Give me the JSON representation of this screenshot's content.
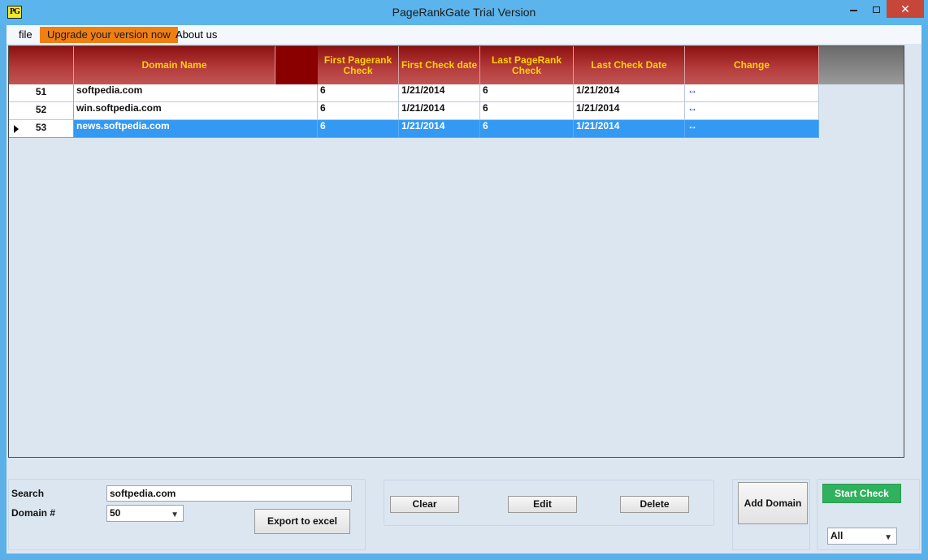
{
  "window": {
    "title": "PageRankGate Trial Version",
    "icon_text": "PG",
    "close_glyph": "✕"
  },
  "menu": {
    "file": "file",
    "upgrade": "Upgrade your version now",
    "about": "About us"
  },
  "colors": {
    "header_bg": "#b43a3a",
    "header_text": "#ffd200",
    "selection": "#3399f2",
    "upgrade_bg": "#f07f12",
    "start_check_bg": "#2fb15d"
  },
  "table": {
    "columns": [
      "Domain Name",
      "First Pagerank Check",
      "First Check date",
      "Last PageRank Check",
      "Last Check Date",
      "Change"
    ],
    "rows": [
      {
        "num": "51",
        "domain": "softpedia.com",
        "first_pr": "6",
        "first_date": "1/21/2014",
        "last_pr": "6",
        "last_date": "1/21/2014",
        "change": "↔",
        "selected": false
      },
      {
        "num": "52",
        "domain": "win.softpedia.com",
        "first_pr": "6",
        "first_date": "1/21/2014",
        "last_pr": "6",
        "last_date": "1/21/2014",
        "change": "↔",
        "selected": false
      },
      {
        "num": "53",
        "domain": "news.softpedia.com",
        "first_pr": "6",
        "first_date": "1/21/2014",
        "last_pr": "6",
        "last_date": "1/21/2014",
        "change": "↔",
        "selected": true
      }
    ]
  },
  "search": {
    "label": "Search",
    "value": "softpedia.com",
    "domain_label": "Domain #",
    "domain_value": "50",
    "export_label": "Export to excel"
  },
  "actions": {
    "clear": "Clear",
    "edit": "Edit",
    "delete": "Delete",
    "add_domain": "Add Domain",
    "start_check": "Start Check",
    "filter_value": "All"
  }
}
